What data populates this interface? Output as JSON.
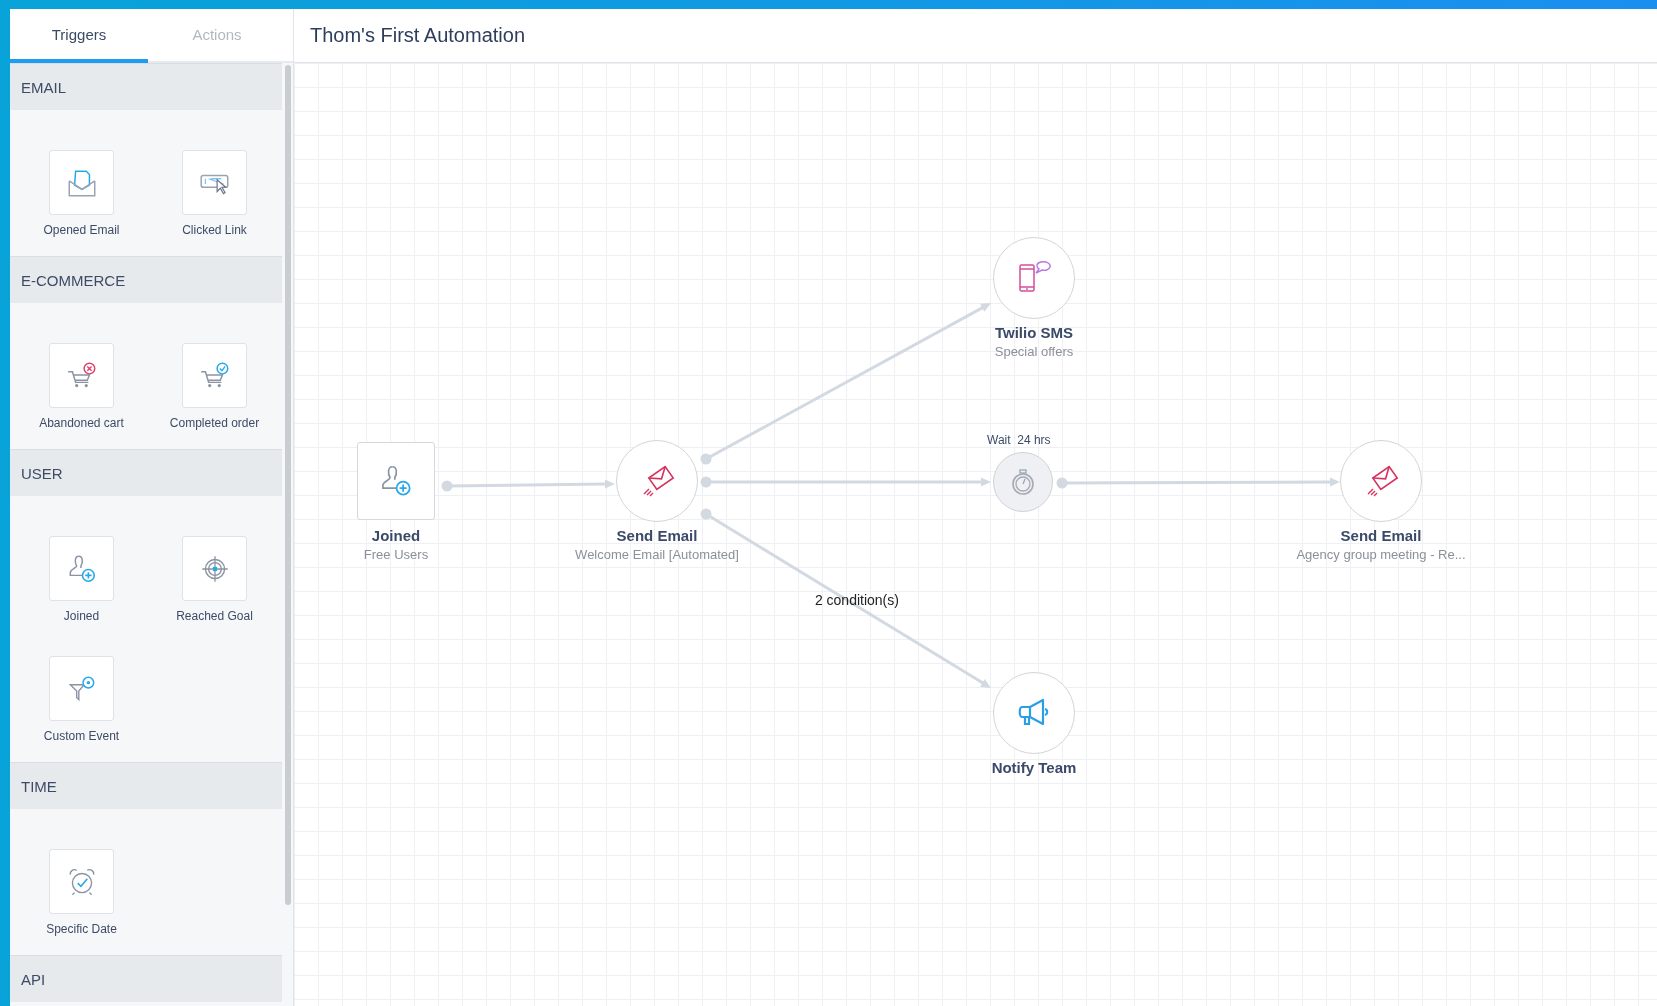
{
  "tabs": [
    {
      "label": "Triggers",
      "selected": true
    },
    {
      "label": "Actions",
      "selected": false
    }
  ],
  "sections": [
    {
      "title": "EMAIL",
      "items": [
        {
          "label": "Opened Email",
          "kind": "envelope"
        },
        {
          "label": "Clicked Link",
          "kind": "link"
        }
      ]
    },
    {
      "title": "E-COMMERCE",
      "items": [
        {
          "label": "Abandoned cart",
          "kind": "cart-remove"
        },
        {
          "label": "Completed order",
          "kind": "cart-check"
        }
      ]
    },
    {
      "title": "USER",
      "items": [
        {
          "label": "Joined",
          "kind": "user-add"
        },
        {
          "label": "Reached Goal",
          "kind": "target"
        },
        {
          "label": "Custom Event",
          "kind": "funnel"
        }
      ]
    },
    {
      "title": "TIME",
      "items": [
        {
          "label": "Specific Date",
          "kind": "alarm"
        }
      ]
    },
    {
      "title": "API"
    }
  ],
  "title": "Thom's First Automation",
  "nodes": [
    {
      "kind": "trigger",
      "title": "Joined",
      "subtitle": "Free Users"
    },
    {
      "kind": "send-email",
      "title": "Send Email",
      "subtitle": "Welcome Email [Automated]"
    },
    {
      "kind": "sms",
      "title": "Twilio SMS",
      "subtitle": "Special offers"
    },
    {
      "kind": "wait",
      "label": "Wait  24 hrs"
    },
    {
      "kind": "send-email",
      "title": "Send Email",
      "subtitle": "Agency group meeting - Re..."
    },
    {
      "kind": "megaphone",
      "title": "Notify Team",
      "incoming_label": "2 condition(s)"
    }
  ]
}
